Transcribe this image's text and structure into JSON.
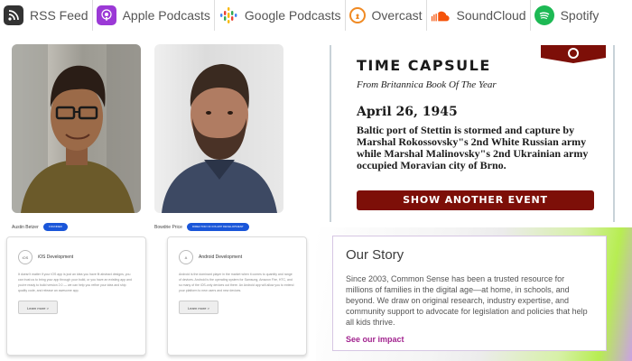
{
  "podcast_bar": {
    "items": [
      {
        "label": "RSS Feed",
        "icon": "rss-icon"
      },
      {
        "label": "Apple Podcasts",
        "icon": "apple-podcasts-icon"
      },
      {
        "label": "Google Podcasts",
        "icon": "google-podcasts-icon"
      },
      {
        "label": "Overcast",
        "icon": "overcast-icon"
      },
      {
        "label": "SoundCloud",
        "icon": "soundcloud-icon"
      },
      {
        "label": "Spotify",
        "icon": "spotify-icon"
      }
    ]
  },
  "team": {
    "members": [
      {
        "name": "Austin Betzer",
        "badge": "Founder"
      },
      {
        "name": "Bowdrie Price",
        "badge": "Director of iOS App Development"
      }
    ],
    "services": [
      {
        "icon_text": "iOS",
        "title": "iOS Development",
        "text": "It doesn't matter if your iOS app is just an idea you have fit abstract designs, you can trust us to bring your app through your build, or you have an existing app and you're ready to build version 2.0 — we can help you refine your idea and ship quality code, and release an awesome app.",
        "button": "Learn more >"
      },
      {
        "icon_text": "A",
        "title": "Android Development",
        "text": "Android is the dominant player in the market when it comes to quantity and range of devices. Android is the operating system for Samsung, Amazon Fire, HTC, and so many of the iOS-only devices out there. An Android app will allow you to extend your platform to new users and new devices.",
        "button": "Learn more >"
      }
    ]
  },
  "time_capsule": {
    "title": "TIME CAPSULE",
    "subtitle": "From Britannica Book Of The Year",
    "date": "April 26, 1945",
    "text": "Baltic port of Stettin is stormed and capture by Marshal Rokossovsky\"s 2nd White Russian army while Marshal Malinovsky\"s 2nd Ukrainian army occupied Moravian city of Brno.",
    "button": "SHOW ANOTHER EVENT"
  },
  "our_story": {
    "title": "Our Story",
    "text": "Since 2003, Common Sense has been a trusted resource for millions of families in the digital age—at home, in schools, and beyond. We draw on original research, industry expertise, and community support to advocate for legislation and policies that help all kids thrive.",
    "link": "See our impact"
  },
  "colors": {
    "capsule_red": "#7d0f08",
    "badge_blue": "#1a56d9",
    "story_link": "#a2248f",
    "spotify_green": "#1db954",
    "apple_purple": "#9b39d6"
  }
}
